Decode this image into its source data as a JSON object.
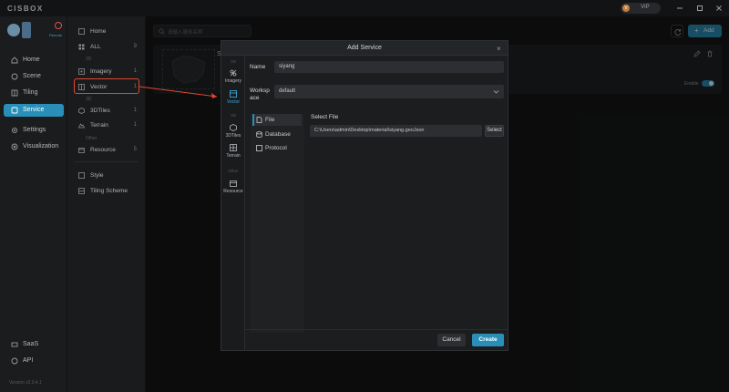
{
  "app": {
    "logo": "CISBOX",
    "vip_label": "VIP",
    "vip_badge": "V"
  },
  "user": {
    "remote_label": "Remote"
  },
  "sidebar": {
    "items": [
      {
        "label": "Home"
      },
      {
        "label": "Scene"
      },
      {
        "label": "Tiling"
      },
      {
        "label": "Service"
      },
      {
        "label": "Settings"
      },
      {
        "label": "Visualization"
      },
      {
        "label": "SaaS"
      },
      {
        "label": "API"
      }
    ],
    "version": "Version v2.0.4.1"
  },
  "sidebar2": {
    "home": "Home",
    "all": {
      "label": "ALL",
      "count": "9"
    },
    "group_2d": "2D",
    "imagery": {
      "label": "Imagery",
      "count": "1"
    },
    "vector": {
      "label": "Vector",
      "count": "1"
    },
    "group_3d": "3D",
    "tiles3d": {
      "label": "3DTiles",
      "count": "1"
    },
    "terrain": {
      "label": "Terrain",
      "count": "1"
    },
    "group_other": "Other",
    "resource": {
      "label": "Resource",
      "count": "5"
    },
    "style": "Style",
    "tiling_scheme": "Tiling Scheme"
  },
  "main": {
    "search_placeholder": "请输入服务名称",
    "add_label": "Add",
    "card_letter": "S",
    "enable_label": "Enable"
  },
  "modal": {
    "title": "Add Service",
    "left": {
      "group_2d": "2D",
      "imagery": "Imagery",
      "vector": "Vector",
      "group_3d": "3D",
      "tiles3d": "3DTiles",
      "terrain": "Terrain",
      "group_other": "Other",
      "resource": "Resource"
    },
    "name_label": "Name",
    "name_value": "siyang",
    "workspace_label_1": "Worksp",
    "workspace_label_2": "ace",
    "workspace_value": "default",
    "tabs": {
      "file": "File",
      "database": "Database",
      "protocol": "Protocol"
    },
    "select_file_label": "Select File",
    "file_path": "C:\\Users\\admin\\Desktop\\material\\siyang.geoJson",
    "select_button": "Select",
    "cancel": "Cancel",
    "create": "Create"
  },
  "colors": {
    "accent": "#2a8fb8",
    "highlight": "#e0482f"
  }
}
